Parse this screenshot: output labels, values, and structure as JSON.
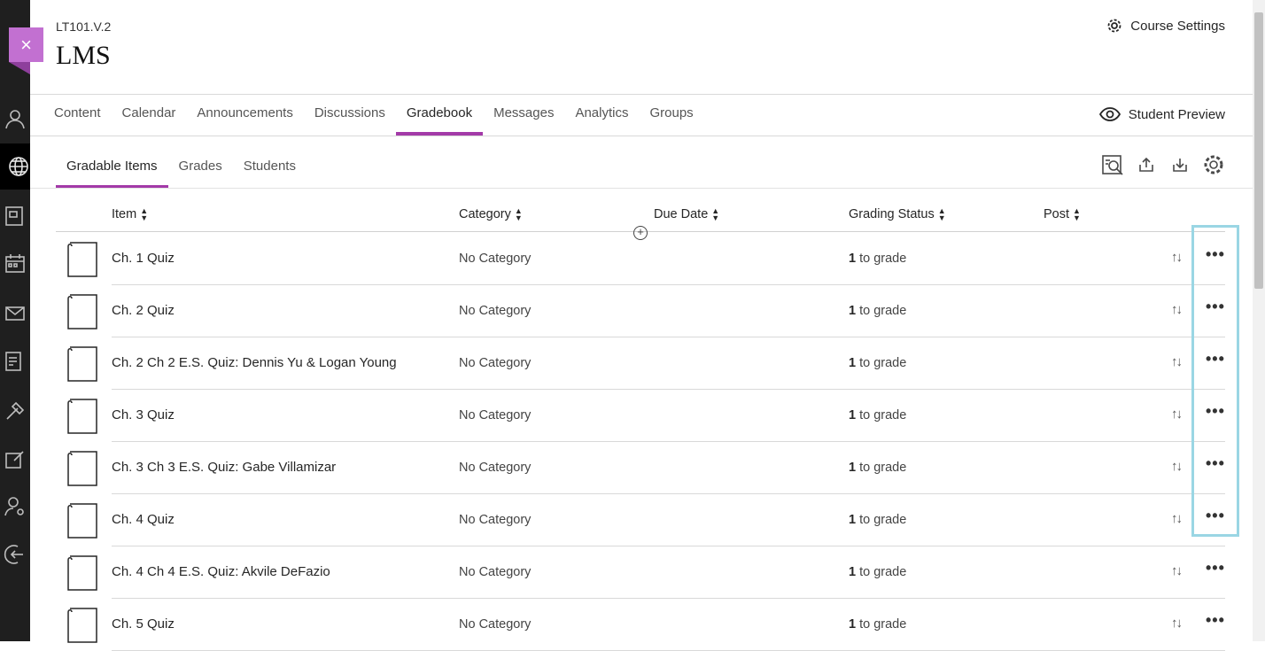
{
  "header": {
    "course_code": "LT101.V.2",
    "course_title": "LMS",
    "course_settings_label": "Course Settings",
    "close_icon": "×"
  },
  "nav": {
    "items": [
      "Content",
      "Calendar",
      "Announcements",
      "Discussions",
      "Gradebook",
      "Messages",
      "Analytics",
      "Groups"
    ],
    "active": "Gradebook",
    "student_preview_label": "Student Preview"
  },
  "subtabs": {
    "items": [
      "Gradable Items",
      "Grades",
      "Students"
    ],
    "active": "Gradable Items"
  },
  "table": {
    "columns": [
      "Item",
      "Category",
      "Due Date",
      "Grading Status",
      "Post"
    ],
    "rows": [
      {
        "name": "Ch. 1 Quiz",
        "category": "No Category",
        "grade_count": "1",
        "grade_text": " to grade"
      },
      {
        "name": "Ch. 2 Quiz",
        "category": "No Category",
        "grade_count": "1",
        "grade_text": " to grade"
      },
      {
        "name": "Ch. 2 Ch 2 E.S. Quiz: Dennis Yu & Logan Young",
        "category": "No Category",
        "grade_count": "1",
        "grade_text": " to grade"
      },
      {
        "name": "Ch. 3 Quiz",
        "category": "No Category",
        "grade_count": "1",
        "grade_text": " to grade"
      },
      {
        "name": "Ch. 3 Ch 3 E.S. Quiz: Gabe Villamizar",
        "category": "No Category",
        "grade_count": "1",
        "grade_text": " to grade"
      },
      {
        "name": "Ch. 4 Quiz",
        "category": "No Category",
        "grade_count": "1",
        "grade_text": " to grade"
      },
      {
        "name": "Ch. 4 Ch 4 E.S. Quiz: Akvile DeFazio",
        "category": "No Category",
        "grade_count": "1",
        "grade_text": " to grade"
      },
      {
        "name": "Ch. 5 Quiz",
        "category": "No Category",
        "grade_count": "1",
        "grade_text": " to grade"
      }
    ]
  },
  "icons": {
    "rail": [
      "user-icon",
      "globe-icon",
      "courses-icon",
      "calendar-icon",
      "mail-icon",
      "grades-icon",
      "tools-icon",
      "edit-icon",
      "admin-icon",
      "sign-out-icon"
    ],
    "toolbar": [
      "search-icon",
      "upload-icon",
      "download-icon",
      "gear-icon"
    ]
  },
  "colors": {
    "accent": "#a33aa8",
    "close_tab": "#c270d1",
    "highlight": "#9ad6e4",
    "rail": "#1f1f1f"
  }
}
